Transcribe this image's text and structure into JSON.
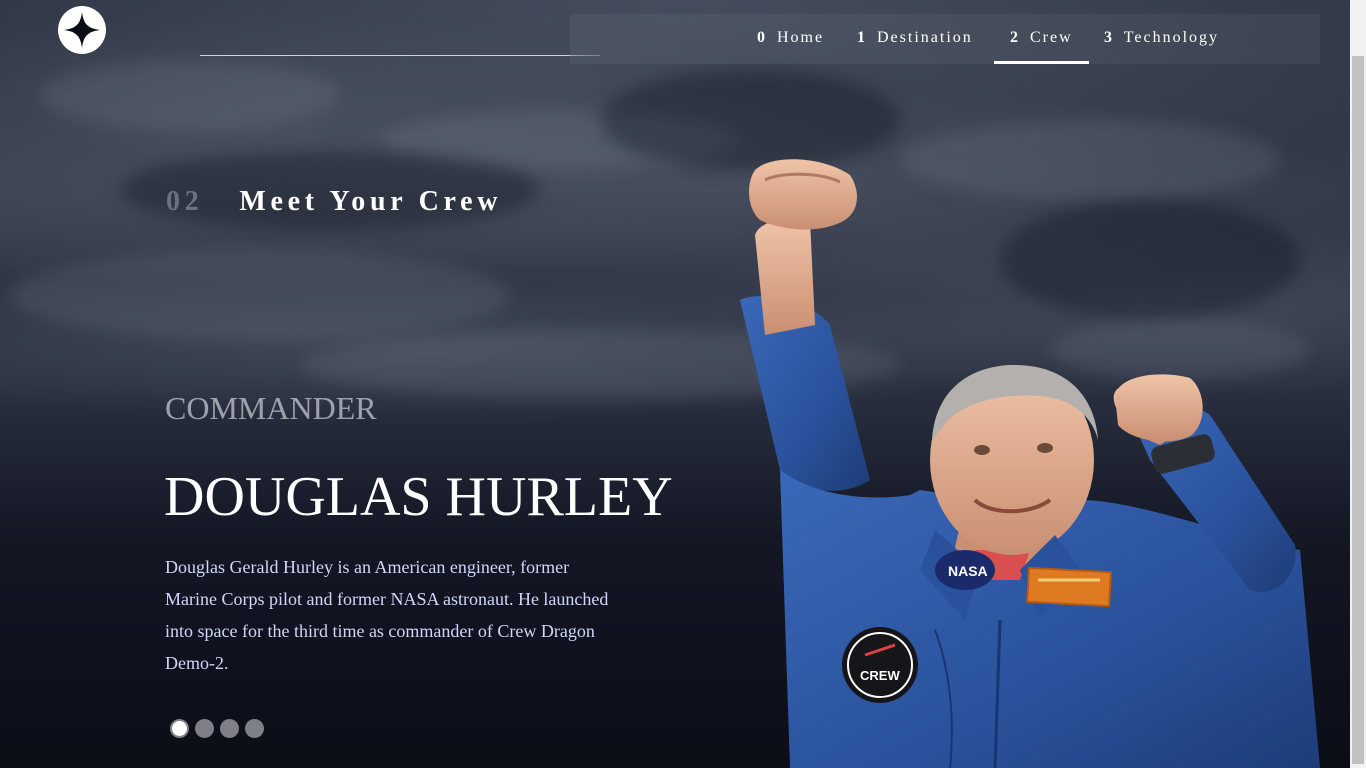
{
  "header": {
    "logo_icon": "four-point-star-icon",
    "nav": [
      {
        "num": "0",
        "label": "Home",
        "active": false
      },
      {
        "num": "1",
        "label": "Destination",
        "active": false
      },
      {
        "num": "2",
        "label": "Crew",
        "active": true
      },
      {
        "num": "3",
        "label": "Technology",
        "active": false
      }
    ]
  },
  "main": {
    "heading_num": "02",
    "heading_text": "Meet Your Crew",
    "role": "COMMANDER",
    "name": "DOUGLAS HURLEY",
    "bio": "Douglas Gerald Hurley is an American engineer, former Marine Corps pilot and former NASA astronaut. He launched into space for the third time as commander of Crew Dragon Demo-2.",
    "slides": {
      "count": 4,
      "active_index": 0
    },
    "image_icon": "astronaut-photo",
    "patch_labels": {
      "nasa": "NASA",
      "crew": "CREW"
    }
  },
  "colors": {
    "background": "#0b0d17",
    "text_primary": "#ffffff",
    "text_secondary": "#d0d6f9",
    "suit_blue": "#2f5aa8"
  }
}
